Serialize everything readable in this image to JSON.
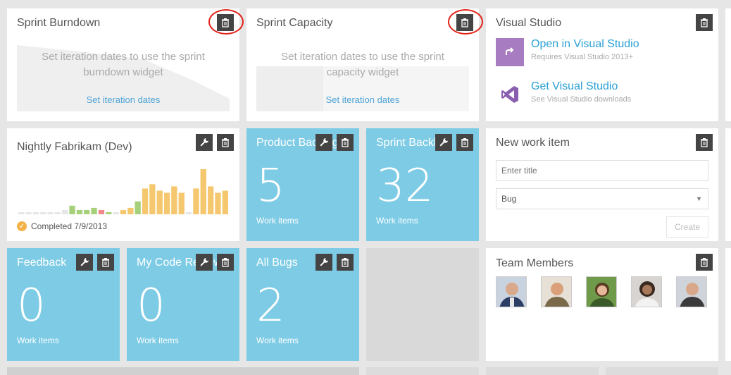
{
  "tiles": {
    "sprint_burndown": {
      "title": "Sprint Burndown",
      "message": "Set iteration dates to use the sprint burndown widget",
      "link": "Set iteration dates"
    },
    "sprint_capacity": {
      "title": "Sprint Capacity",
      "message": "Set iteration dates to use the sprint capacity widget",
      "link": "Set iteration dates"
    },
    "visual_studio": {
      "title": "Visual Studio",
      "open_link": "Open in Visual Studio",
      "open_desc": "Requires Visual Studio 2013+",
      "get_link": "Get Visual Studio",
      "get_desc": "See Visual Studio downloads"
    },
    "nightly": {
      "title": "Nightly Fabrikam (Dev)",
      "status": "Completed 7/9/2013",
      "chart_data": {
        "type": "bar",
        "values": [
          1,
          1,
          1,
          1,
          1,
          1,
          2,
          4,
          2,
          2,
          3,
          2,
          1,
          1,
          2,
          3,
          6,
          12,
          14,
          11,
          10,
          13,
          10,
          1,
          12,
          21,
          13,
          10,
          11
        ],
        "colors": [
          "#e6e6e6",
          "#e6e6e6",
          "#e6e6e6",
          "#e6e6e6",
          "#e6e6e6",
          "#e6e6e6",
          "#e6e6e6",
          "#a6d07a",
          "#a6d07a",
          "#a6d07a",
          "#a6d07a",
          "#f08a8a",
          "#a6d07a",
          "#e6e6e6",
          "#f5c76e",
          "#f5c76e",
          "#a6d07a",
          "#f5c76e",
          "#f5c76e",
          "#f5c76e",
          "#f5c76e",
          "#f5c76e",
          "#f5c76e",
          "#e6e6e6",
          "#f5c76e",
          "#f5c76e",
          "#f5c76e",
          "#f5c76e",
          "#f5c76e"
        ]
      }
    },
    "product_backlog": {
      "title": "Product Backlog",
      "count": "5",
      "sub": "Work items"
    },
    "sprint_backlog": {
      "title": "Sprint Backlog",
      "count": "32",
      "sub": "Work items"
    },
    "new_work_item": {
      "title": "New work item",
      "title_placeholder": "Enter title",
      "type_value": "Bug",
      "create_label": "Create"
    },
    "feedback": {
      "title": "Feedback",
      "count": "0",
      "sub": "Work items"
    },
    "code_reviews": {
      "title": "My Code Reviews",
      "count": "0",
      "sub": "Work items"
    },
    "all_bugs": {
      "title": "All Bugs",
      "count": "2",
      "sub": "Work items"
    },
    "team_members": {
      "title": "Team Members"
    }
  },
  "colors": {
    "tile_blue": "#7dcbe5",
    "accent_red": "#e2231a",
    "link": "#4da3d6",
    "button": "#444444"
  }
}
